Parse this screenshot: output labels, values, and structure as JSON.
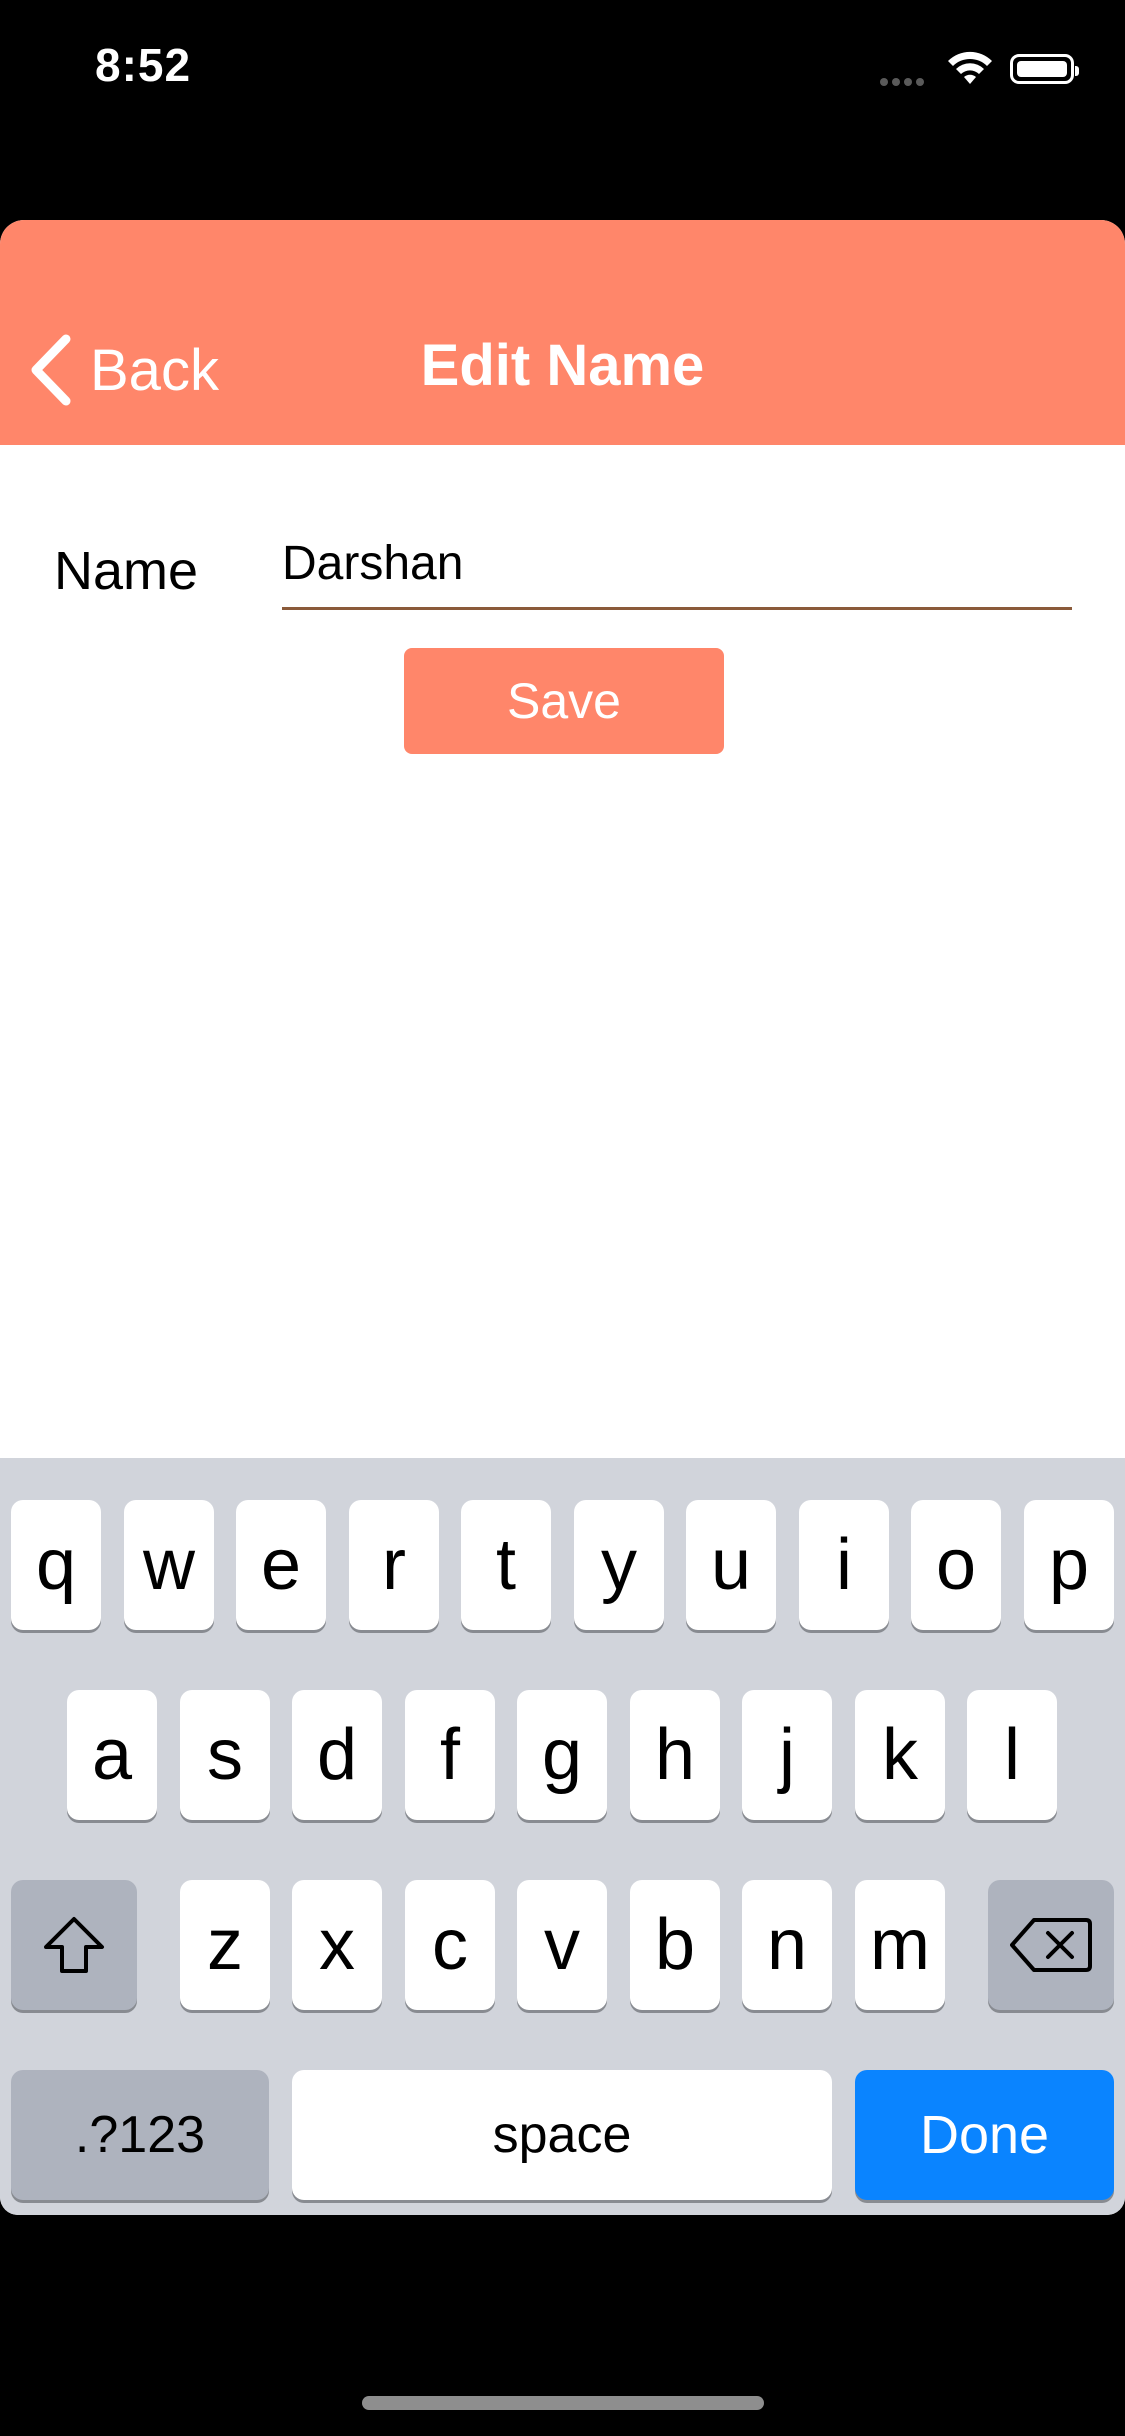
{
  "status_bar": {
    "time": "8:52"
  },
  "navbar": {
    "back_label": "Back",
    "title": "Edit Name",
    "color": "#FF866A"
  },
  "form": {
    "name_label": "Name",
    "name_value": "Darshan",
    "save_label": "Save"
  },
  "keyboard": {
    "row1": [
      "q",
      "w",
      "e",
      "r",
      "t",
      "y",
      "u",
      "i",
      "o",
      "p"
    ],
    "row2": [
      "a",
      "s",
      "d",
      "f",
      "g",
      "h",
      "j",
      "k",
      "l"
    ],
    "row3": [
      "z",
      "x",
      "c",
      "v",
      "b",
      "n",
      "m"
    ],
    "numbers_label": ".?123",
    "space_label": "space",
    "done_label": "Done",
    "done_color": "#0A84FF"
  }
}
